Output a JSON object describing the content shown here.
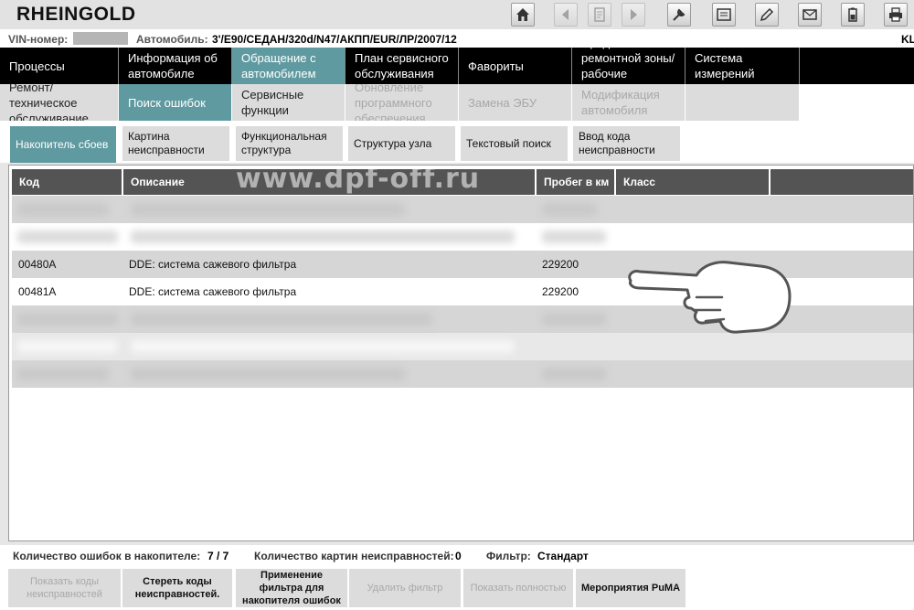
{
  "app": {
    "title": "RHEINGOLD"
  },
  "vehicle": {
    "vin_label": "VIN-номер:",
    "car_label": "Автомобиль:",
    "car_value": "3'/E90/СЕДАН/320d/N47/АКПП/EUR/ЛР/2007/12",
    "right_text": "KL"
  },
  "main_nav": [
    {
      "label": "Процессы"
    },
    {
      "label": "Информация об автомобиле"
    },
    {
      "label": "Обращение с автомобилем"
    },
    {
      "label": "План сервисного обслуживания"
    },
    {
      "label": "Фавориты"
    },
    {
      "label": "Средства ремонтной зоны/ рабочие жидкости"
    },
    {
      "label": "Система измерений"
    }
  ],
  "sub_nav": [
    {
      "label": "Ремонт/ техническое обслуживание"
    },
    {
      "label": "Поиск ошибок"
    },
    {
      "label": "Сервисные функции"
    },
    {
      "label": "Обновление программного обеспечения"
    },
    {
      "label": "Замена ЭБУ"
    },
    {
      "label": "Модификация автомобиля"
    }
  ],
  "tabs": [
    {
      "label": "Накопитель сбоев"
    },
    {
      "label": "Картина неисправности"
    },
    {
      "label": "Функциональная структура"
    },
    {
      "label": "Структура узла"
    },
    {
      "label": "Текстовый поиск"
    },
    {
      "label": "Ввод кода неисправности"
    }
  ],
  "table": {
    "headers": [
      "Код",
      "Описание",
      "Пробег в км",
      "Класс"
    ],
    "rows": [
      {
        "code": "00480A",
        "description": "DDE: система сажевого фильтра",
        "mileage": "229200"
      },
      {
        "code": "00481A",
        "description": "DDE: система сажевого фильтра",
        "mileage": "229200"
      }
    ]
  },
  "watermark": "www.dpf-off.ru",
  "summary": {
    "errors_label": "Количество ошибок в накопителе:",
    "errors_value": "7 / 7",
    "faults_label": "Количество картин неисправностей:",
    "faults_value": "0",
    "filter_label": "Фильтр:",
    "filter_value": "Стандарт"
  },
  "footer_buttons": [
    {
      "label": "Показать коды неисправностей"
    },
    {
      "label": "Стереть коды неисправностей."
    },
    {
      "label": "Применение фильтра для накопителя ошибок"
    },
    {
      "label": "Удалить фильтр"
    },
    {
      "label": "Показать полностью"
    },
    {
      "label": "Мероприятия PuMA"
    }
  ],
  "toolbar_icons": [
    "home-icon",
    "back-icon",
    "document-icon",
    "forward-icon",
    "wrench-icon",
    "card-icon",
    "pen-icon",
    "mail-icon",
    "battery-icon",
    "printer-icon"
  ]
}
